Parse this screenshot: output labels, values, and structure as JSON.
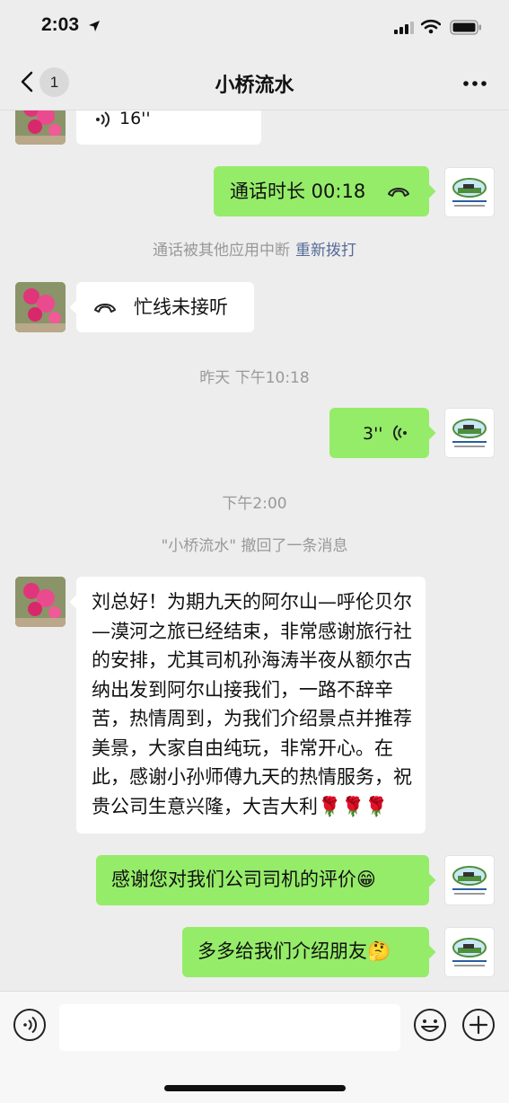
{
  "status_bar": {
    "time": "2:03"
  },
  "nav": {
    "unread_count": "1",
    "title": "小桥流水"
  },
  "messages": {
    "m1_voice_duration": "16''",
    "m2_call_text": "通话时长 00:18",
    "m3_system_text": "通话被其他应用中断",
    "m3_system_link": "重新拨打",
    "m4_call_text": "忙线未接听",
    "m5_timestamp": "昨天 下午10:18",
    "m6_voice_duration": "3''",
    "m7_timestamp": "下午2:00",
    "m8_recall_text": "\"小桥流水\" 撤回了一条消息",
    "m9_text": "刘总好！为期九天的阿尔山—呼伦贝尔—漠河之旅已经结束，非常感谢旅行社的安排，尤其司机孙海涛半夜从额尔古纳出发到阿尔山接我们，一路不辞辛苦，热情周到，为我们介绍景点并推荐美景，大家自由纯玩，非常开心。在此，感谢小孙师傅九天的热情服务，祝贵公司生意兴隆，大吉大利🌹🌹🌹",
    "m10_text": "感谢您对我们公司司机的评价😁",
    "m11_text": "多多给我们介绍朋友🤔"
  },
  "colors": {
    "sent_bubble": "#95ec69",
    "received_bubble": "#ffffff",
    "link": "#576b95",
    "background": "#ededed"
  }
}
